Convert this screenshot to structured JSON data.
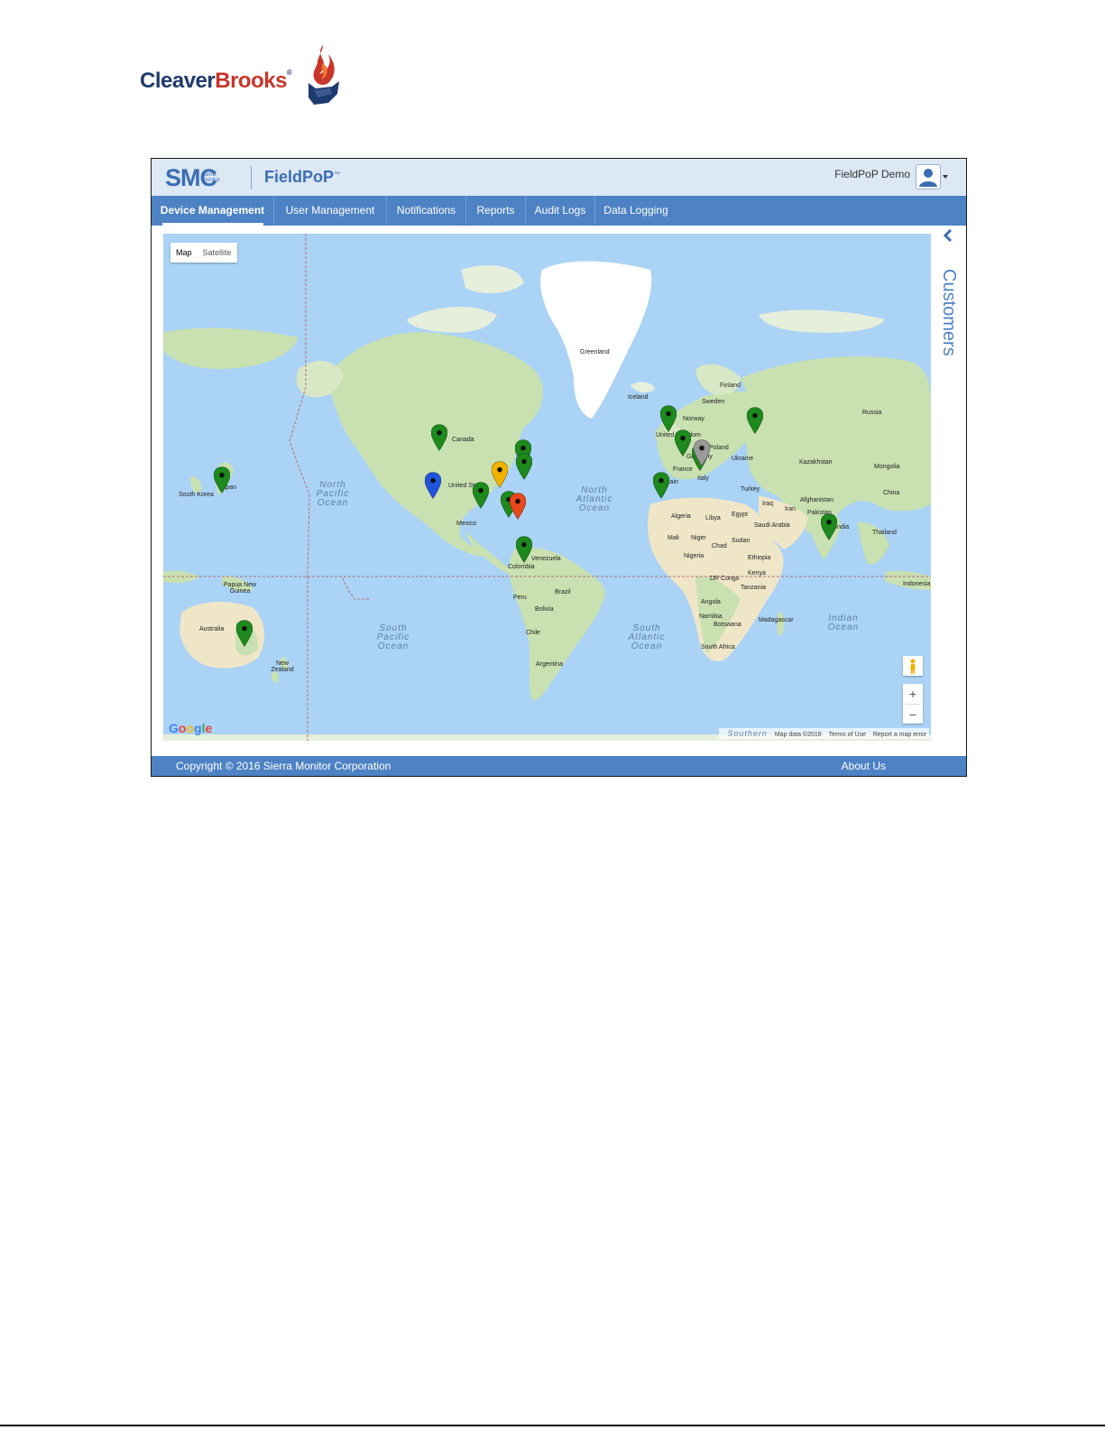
{
  "logo": {
    "cleaver": "Cleaver",
    "brooks": "Brooks",
    "reg": "®"
  },
  "header": {
    "brand": "SMC",
    "brand_sub": "sierra monitor",
    "product": "FieldPoP",
    "product_tm": "™",
    "user_name": "FieldPoP Demo",
    "user_icon": "user-icon"
  },
  "nav": {
    "items": [
      {
        "label": "Device Management",
        "active": true
      },
      {
        "label": "User Management"
      },
      {
        "label": "Notifications"
      },
      {
        "label": "Reports"
      },
      {
        "label": "Audit Logs"
      },
      {
        "label": "Data Logging"
      }
    ]
  },
  "map": {
    "type_map": "Map",
    "type_satellite": "Satellite",
    "google": "Google",
    "attribution": {
      "southern": "Southern",
      "map_data": "Map data ©2016",
      "terms": "Terms of Use",
      "report": "Report a map error"
    },
    "labels": [
      "Greenland",
      "Iceland",
      "Finland",
      "Sweden",
      "Norway",
      "Russia",
      "United Kingdom",
      "Poland",
      "Germany",
      "France",
      "Ukraine",
      "Kazakhstan",
      "Mongolia",
      "Italy",
      "Spain",
      "Turkey",
      "China",
      "Afghanistan",
      "Iraq",
      "Iran",
      "Pakistan",
      "India",
      "Algeria",
      "Libya",
      "Egypt",
      "Saudi Arabia",
      "Thailand",
      "Mali",
      "Niger",
      "Chad",
      "Sudan",
      "Nigeria",
      "Ethiopia",
      "DR Congo",
      "Kenya",
      "Tanzania",
      "Angola",
      "Namibia",
      "Botswana",
      "Madagascar",
      "South Africa",
      "Indonesia",
      "Canada",
      "United States",
      "Mexico",
      "Venezuela",
      "Colombia",
      "Peru",
      "Brazil",
      "Bolivia",
      "Chile",
      "Argentina",
      "Japan",
      "South Korea",
      "Papua New Guinea",
      "Australia",
      "New Zealand"
    ],
    "oceans": {
      "north_pacific": "North Pacific Ocean",
      "north_atlantic": "North Atlantic Ocean",
      "south_pacific": "South Pacific Ocean",
      "south_atlantic": "South Atlantic Ocean",
      "indian": "Indian Ocean"
    },
    "marker_colors": {
      "green": "#1e8a1e",
      "blue": "#2255dd",
      "yellow": "#f0b400",
      "red": "#e8481c",
      "gray": "#9a9a9a"
    }
  },
  "sidebar": {
    "label": "Customers"
  },
  "footer": {
    "copyright": "Copyright © 2016 Sierra Monitor Corporation",
    "about": "About Us"
  }
}
